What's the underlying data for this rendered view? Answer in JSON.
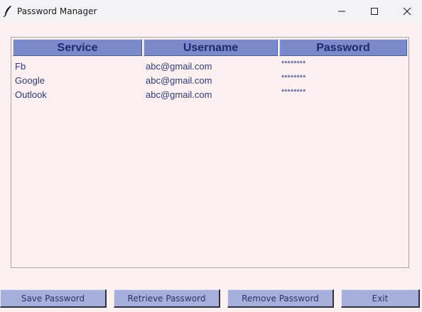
{
  "window": {
    "title": "Password Manager",
    "controls": {
      "minimize": "minimize-icon",
      "maximize": "maximize-icon",
      "close": "close-icon"
    }
  },
  "table": {
    "columns": [
      "Service",
      "Username",
      "Password"
    ],
    "rows": [
      {
        "service": "Fb",
        "username": "abc@gmail.com",
        "password": "********"
      },
      {
        "service": "Google",
        "username": "abc@gmail.com",
        "password": "********"
      },
      {
        "service": "Outlook",
        "username": "abc@gmail.com",
        "password": "********"
      }
    ]
  },
  "buttons": {
    "save": "Save Password",
    "retrieve": "Retrieve Password",
    "remove": "Remove Password",
    "exit": "Exit"
  },
  "colors": {
    "background": "#fdf0f0",
    "header_bg": "#7b8acb",
    "header_text": "#1e2a6e",
    "button_bg": "#a7b0dc",
    "cell_text": "#2c3a7a"
  }
}
